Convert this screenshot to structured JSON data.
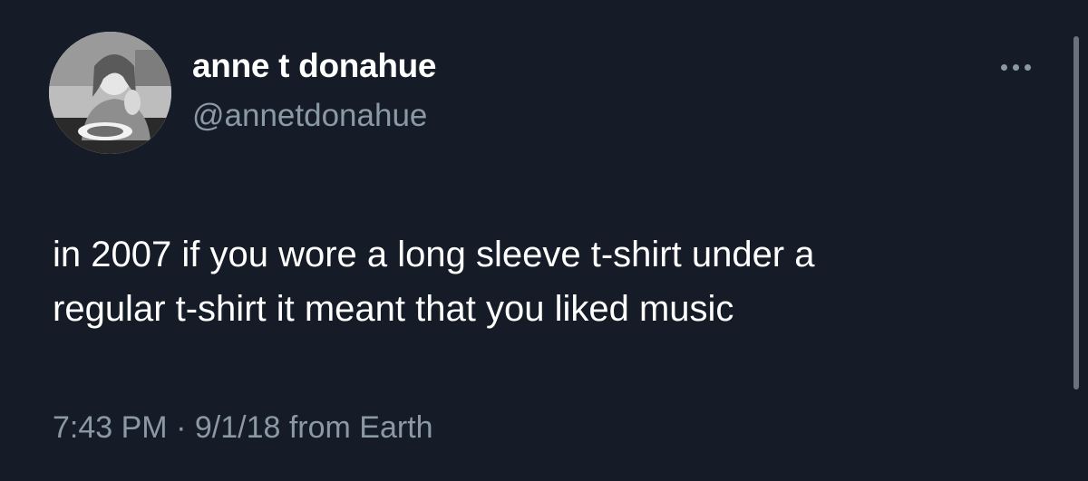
{
  "colors": {
    "background": "#151c27",
    "text_primary": "#ffffff",
    "text_secondary": "#8b98a5"
  },
  "author": {
    "avatar_icon": "avatar-photo",
    "display_name": "anne t donahue",
    "handle": "@annetdonahue"
  },
  "more_icon": "ellipsis-icon",
  "tweet": {
    "lines": [
      "in 2007 if you wore a long sleeve t-shirt under a",
      "regular t-shirt it meant that you liked music"
    ]
  },
  "meta": {
    "time": "7:43 PM",
    "separator": "·",
    "date": "9/1/18",
    "source": "from Earth"
  }
}
